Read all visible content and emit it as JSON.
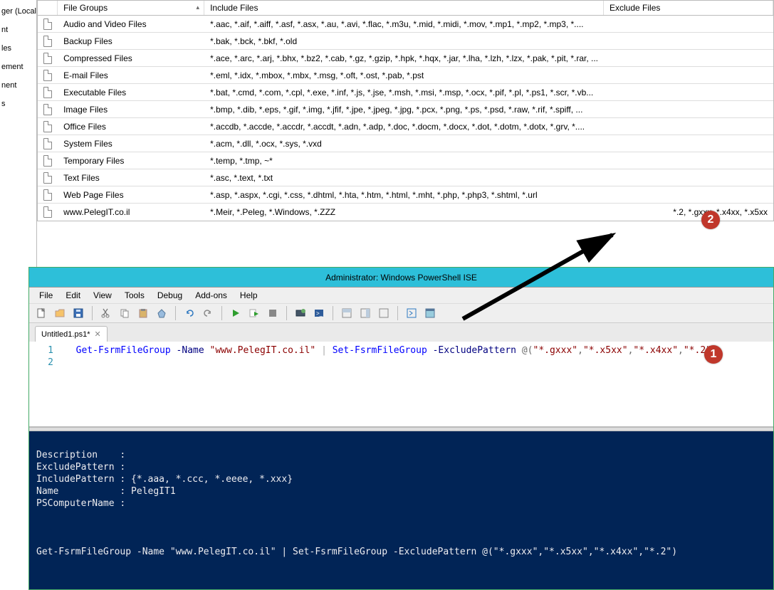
{
  "fsrm": {
    "left_items": [
      "ger (Local)",
      "",
      "nt",
      "",
      "les",
      "",
      "ement",
      "nent",
      "s"
    ],
    "columns": {
      "icon": "",
      "file_groups": "File Groups",
      "include": "Include Files",
      "exclude": "Exclude Files"
    },
    "rows": [
      {
        "name": "Audio and Video Files",
        "include": "*.aac, *.aif, *.aiff, *.asf, *.asx, *.au, *.avi, *.flac, *.m3u, *.mid, *.midi, *.mov, *.mp1, *.mp2, *.mp3, *....",
        "exclude": ""
      },
      {
        "name": "Backup Files",
        "include": "*.bak, *.bck, *.bkf, *.old",
        "exclude": ""
      },
      {
        "name": "Compressed Files",
        "include": "*.ace, *.arc, *.arj, *.bhx, *.bz2, *.cab, *.gz, *.gzip, *.hpk, *.hqx, *.jar, *.lha, *.lzh, *.lzx, *.pak, *.pit, *.rar, ...",
        "exclude": ""
      },
      {
        "name": "E-mail Files",
        "include": "*.eml, *.idx, *.mbox, *.mbx, *.msg, *.oft, *.ost, *.pab, *.pst",
        "exclude": ""
      },
      {
        "name": "Executable Files",
        "include": "*.bat, *.cmd, *.com, *.cpl, *.exe, *.inf, *.js, *.jse, *.msh, *.msi, *.msp, *.ocx, *.pif, *.pl, *.ps1, *.scr, *.vb...",
        "exclude": ""
      },
      {
        "name": "Image Files",
        "include": "*.bmp, *.dib, *.eps, *.gif, *.img, *.jfif, *.jpe, *.jpeg, *.jpg, *.pcx, *.png, *.ps, *.psd, *.raw, *.rif, *.spiff, ...",
        "exclude": ""
      },
      {
        "name": "Office Files",
        "include": "*.accdb, *.accde, *.accdr, *.accdt, *.adn, *.adp, *.doc, *.docm, *.docx, *.dot, *.dotm, *.dotx, *.grv, *....",
        "exclude": ""
      },
      {
        "name": "System Files",
        "include": "*.acm, *.dll, *.ocx, *.sys, *.vxd",
        "exclude": ""
      },
      {
        "name": "Temporary Files",
        "include": "*.temp, *.tmp, ~*",
        "exclude": ""
      },
      {
        "name": "Text Files",
        "include": "*.asc, *.text, *.txt",
        "exclude": ""
      },
      {
        "name": "Web Page Files",
        "include": "*.asp, *.aspx, *.cgi, *.css, *.dhtml, *.hta, *.htm, *.html, *.mht, *.php, *.php3, *.shtml, *.url",
        "exclude": ""
      },
      {
        "name": "www.PelegIT.co.il",
        "include": "*.Meir, *.Peleg, *.Windows, *.ZZZ",
        "exclude": "*.2, *.gxxx, *.x4xx, *.x5xx"
      }
    ]
  },
  "callouts": {
    "c1": "1",
    "c2": "2"
  },
  "ise": {
    "title": "Administrator: Windows PowerShell ISE",
    "menu": [
      "File",
      "Edit",
      "View",
      "Tools",
      "Debug",
      "Add-ons",
      "Help"
    ],
    "tab": "Untitled1.ps1*",
    "gutter": [
      "1",
      "2"
    ],
    "code": {
      "cmd1": "Get-FsrmFileGroup",
      "p_name": "-Name",
      "str_name": "\"www.PelegIT.co.il\"",
      "pipe": "|",
      "cmd2": "Set-FsrmFileGroup",
      "p_excl": "-ExcludePattern",
      "arr_open": "@(",
      "s1": "\"*.gxxx\"",
      "comma": ",",
      "s2": "\"*.x5xx\"",
      "s3": "\"*.x4xx\"",
      "s4": "\"*.2\"",
      "arr_close": ")"
    },
    "console": "\nDescription    :\nExcludePattern :\nIncludePattern : {*.aaa, *.ccc, *.eeee, *.xxx}\nName           : PelegIT1\nPSComputerName :\n\n\n\nGet-FsrmFileGroup -Name \"www.PelegIT.co.il\" | Set-FsrmFileGroup -ExcludePattern @(\"*.gxxx\",\"*.x5xx\",\"*.x4xx\",\"*.2\")\n"
  }
}
